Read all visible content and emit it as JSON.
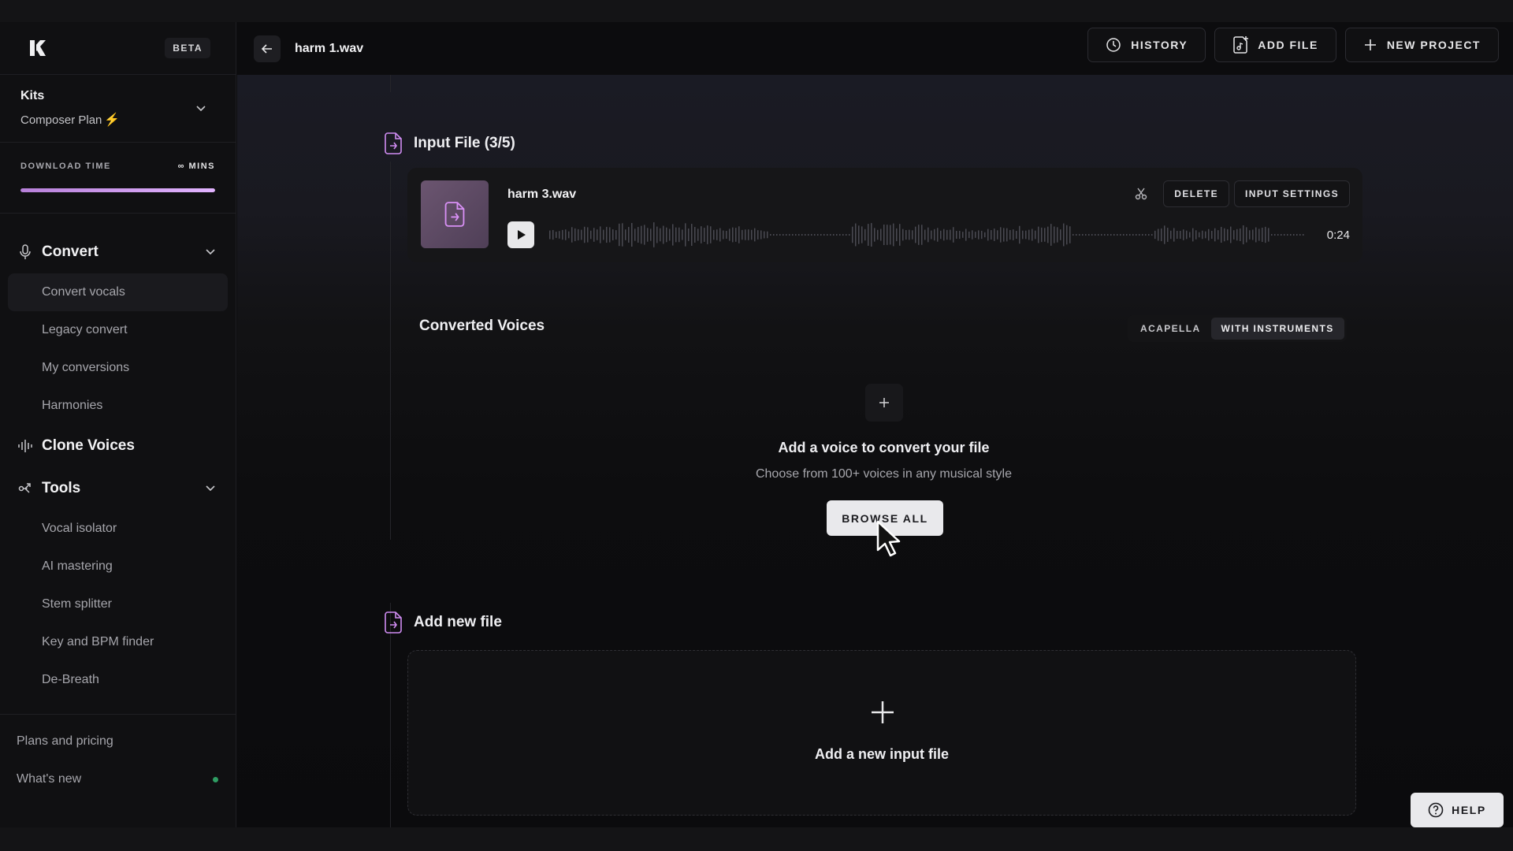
{
  "sidebar": {
    "beta_label": "BETA",
    "account": {
      "name": "Kits",
      "plan": "Composer Plan"
    },
    "download": {
      "label": "DOWNLOAD TIME",
      "value": "∞ MINS",
      "progress": 1.0
    },
    "sections": [
      {
        "label": "Convert",
        "icon": "microphone-icon",
        "items": [
          "Convert vocals",
          "Legacy convert",
          "My conversions",
          "Harmonies"
        ]
      },
      {
        "label": "Clone Voices",
        "icon": "waveform-icon",
        "items": []
      },
      {
        "label": "Tools",
        "icon": "tools-icon",
        "items": [
          "Vocal isolator",
          "AI mastering",
          "Stem splitter",
          "Key and BPM finder",
          "De-Breath"
        ]
      }
    ],
    "bottom_links": [
      "Plans and pricing",
      "What's new"
    ]
  },
  "header": {
    "title": "harm 1.wav",
    "history_label": "HISTORY",
    "add_file_label": "ADD FILE",
    "new_project_label": "NEW PROJECT"
  },
  "main": {
    "input_section_title": "Input File (3/5)",
    "input_file": {
      "name": "harm 3.wav",
      "duration": "0:24",
      "delete_label": "DELETE",
      "settings_label": "INPUT SETTINGS"
    },
    "converted": {
      "title": "Converted Voices",
      "toggle": [
        "ACAPELLA",
        "WITH INSTRUMENTS"
      ],
      "selected": "WITH INSTRUMENTS",
      "empty_title": "Add a voice to convert your file",
      "empty_sub": "Choose from 100+ voices in any musical style",
      "browse_label": "BROWSE ALL"
    },
    "add_section_title": "Add new file",
    "add_input_label": "Add a new input file"
  },
  "help_label": "HELP",
  "colors": {
    "accent": "#c266f2",
    "online": "#2f9d63"
  }
}
